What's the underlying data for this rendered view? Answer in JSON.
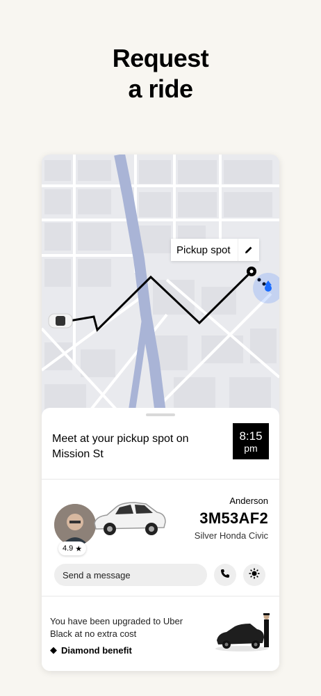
{
  "headline": {
    "line1": "Request",
    "line2": "a ride"
  },
  "map": {
    "pickup_label": "Pickup spot",
    "edit_icon": "pencil-icon",
    "route_color": "#000000",
    "highway_color": "#a9b4d6",
    "location_color": "#1a6cff"
  },
  "trip": {
    "meet_text": "Meet at your pickup spot on Mission St",
    "eta_time": "8:15",
    "eta_period": "pm"
  },
  "driver": {
    "rating": "4.9",
    "rating_icon": "star-icon",
    "name": "Anderson",
    "plate": "3M53AF2",
    "car": "Silver Honda Civic"
  },
  "contact": {
    "message_placeholder": "Send a message",
    "phone_icon": "phone-icon",
    "safety_icon": "safety-icon"
  },
  "promo": {
    "text": "You have been upgraded to Uber Black at no extra cost",
    "benefit": "Diamond benefit",
    "benefit_icon": "diamond-icon"
  }
}
